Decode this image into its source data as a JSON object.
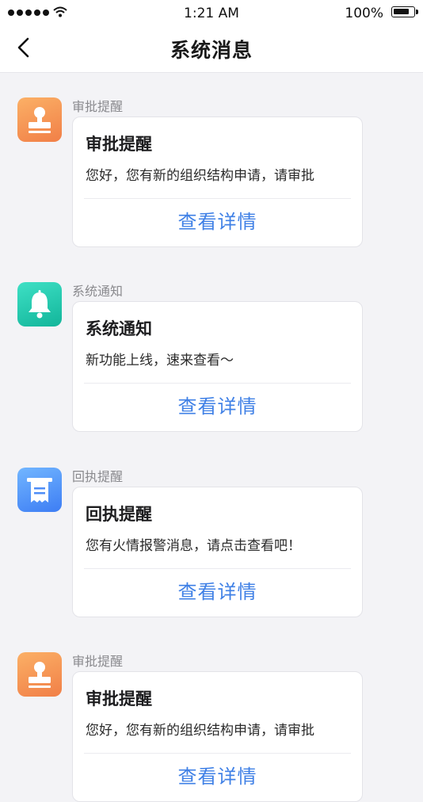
{
  "status_bar": {
    "time": "1:21 AM",
    "battery": "100%"
  },
  "nav": {
    "title": "系统消息",
    "back_icon": "chevron-left-icon"
  },
  "messages": [
    {
      "sender": "审批提醒",
      "icon": "stamp-icon",
      "title": "审批提醒",
      "body": "您好，您有新的组织结构申请，请审批",
      "link": "查看详情"
    },
    {
      "sender": "系统通知",
      "icon": "bell-icon",
      "title": "系统通知",
      "body": "新功能上线，速来查看～",
      "link": "查看详情"
    },
    {
      "sender": "回执提醒",
      "icon": "receipt-icon",
      "title": "回执提醒",
      "body": "您有火情报警消息，请点击查看吧！",
      "link": "查看详情"
    },
    {
      "sender": "审批提醒",
      "icon": "stamp-icon",
      "title": "审批提醒",
      "body": "您好，您有新的组织结构申请，请审批",
      "link": "查看详情"
    }
  ],
  "colors": {
    "accent": "#3f80e6",
    "background": "#f3f3f6",
    "approval_icon": "#f38a4c",
    "notice_icon": "#1ec8aa",
    "receipt_icon": "#4f8ef7"
  }
}
